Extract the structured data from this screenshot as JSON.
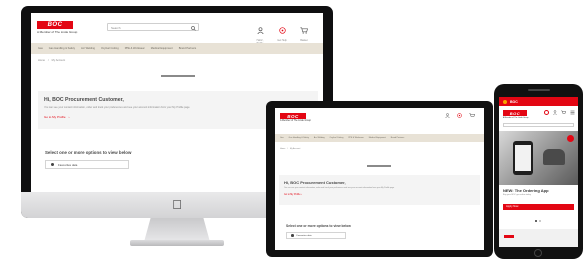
{
  "brand": {
    "logo_text": "BOC",
    "tagline": "A Member of The Linde Group",
    "accent": "#e30613",
    "nav_bg": "#e8e2d6"
  },
  "desktop": {
    "search_placeholder": "Search",
    "header_icons": [
      {
        "icon": "user-icon",
        "label": "Hello!, Profile"
      },
      {
        "icon": "help-icon",
        "label": "Get Help"
      },
      {
        "icon": "cart-icon",
        "label": "Basket"
      }
    ],
    "nav_items": [
      "Gas",
      "Gas Handling & Safety",
      "Arc Welding",
      "Oxyfuel Cutting",
      "PPE & Workwear",
      "Medical Equipment",
      "Brand Partners"
    ],
    "breadcrumb": [
      "Home",
      "My Account"
    ],
    "greeting": "Hi, BOC Procurement Customer,",
    "intro_text": "You can see your contact information, order and track your preferences and see your account information from your My Profile page",
    "profile_link": "Go to My Profile",
    "options_heading": "Select one or more options to view below",
    "option_label": "Favourites data"
  },
  "laptop": {
    "tagline": "A Member of The Linde Group",
    "nav_items": [
      "Gas",
      "Gas Handling & Safety",
      "Arc Welding",
      "Oxyfuel Cutting",
      "PPE & Workwear",
      "Medical Equipment",
      "Brand Partners"
    ],
    "breadcrumb": [
      "Home",
      "My Account"
    ],
    "greeting": "Hi, BOC Procurement Customer,",
    "intro_text": "You can see your contact information, order and track your preferences and see your account information from your My Profile page",
    "profile_link": "Go to My Profile",
    "options_heading": "Select one or more options to view below",
    "option_label": "Favourites data"
  },
  "phone": {
    "top_bar_text": "BOC",
    "promo_title": "NEW: The Ordering App",
    "promo_text": "Buy your BOC gas online today",
    "promo_button": "Apply Now"
  }
}
